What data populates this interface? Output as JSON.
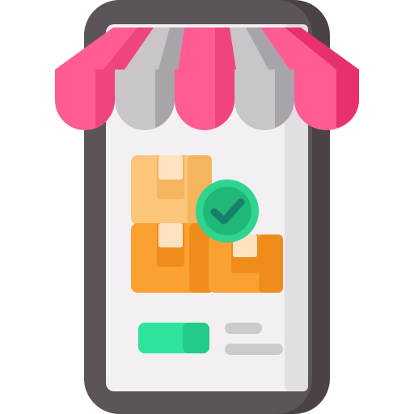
{
  "icon": {
    "name": "mobile-shop-icon",
    "parts": [
      "smartphone-icon",
      "awning-icon",
      "boxes-icon",
      "check-icon",
      "button",
      "text-lines"
    ]
  },
  "colors": {
    "phone_dark": "#5b5458",
    "phone_darker": "#4a4246",
    "screen": "#f2f0f2",
    "screen_shade": "#dcd8dc",
    "awning_pink": "#ff5c94",
    "awning_pink_dark": "#f0447e",
    "awning_pink_deep": "#e8306e",
    "awning_gray": "#c9c5c9",
    "awning_gray_dark": "#a9a4a9",
    "box_light": "#fbc57a",
    "box_light_shade": "#f5b45e",
    "box_orange": "#fba132",
    "box_orange_shade": "#f08c1c",
    "tape": "#fde3c0",
    "check_green": "#2fd48f",
    "check_green_dark": "#1fb877",
    "check_mark": "#17806a",
    "button_green": "#2ee39b",
    "button_green_dark": "#22cc86",
    "line_gray": "#cdc9cd"
  }
}
